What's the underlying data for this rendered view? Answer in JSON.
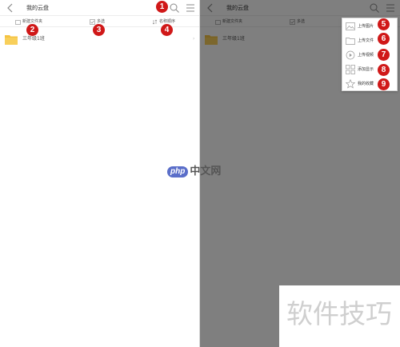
{
  "left_screen": {
    "header": {
      "title": "我的云盘"
    },
    "toolbar": {
      "new_folder": "新建文件夹",
      "multi_select": "多选",
      "sort": "名称顺序"
    },
    "files": [
      {
        "name": "三年级1班"
      }
    ]
  },
  "right_screen": {
    "header": {
      "title": "我的云盘"
    },
    "toolbar": {
      "new_folder": "新建文件夹",
      "multi_select": "多选"
    },
    "files": [
      {
        "name": "三年级1班"
      }
    ],
    "popup_menu": [
      {
        "label": "上传图片",
        "icon": "image-icon"
      },
      {
        "label": "上传文件",
        "icon": "file-folder-icon"
      },
      {
        "label": "上传视频",
        "icon": "video-icon"
      },
      {
        "label": "添加显示",
        "icon": "grid-icon"
      },
      {
        "label": "我的收藏",
        "icon": "star-icon"
      }
    ]
  },
  "markers": [
    "1",
    "2",
    "3",
    "4",
    "5",
    "6",
    "7",
    "8",
    "9"
  ],
  "watermarks": {
    "center_pill": "php",
    "center_text": "中文网",
    "corner": "软件技巧"
  },
  "colors": {
    "marker": "#d01818",
    "folder": "#f5c342",
    "overlay": "#808080",
    "watermark_pill": "#5a6ec9"
  }
}
